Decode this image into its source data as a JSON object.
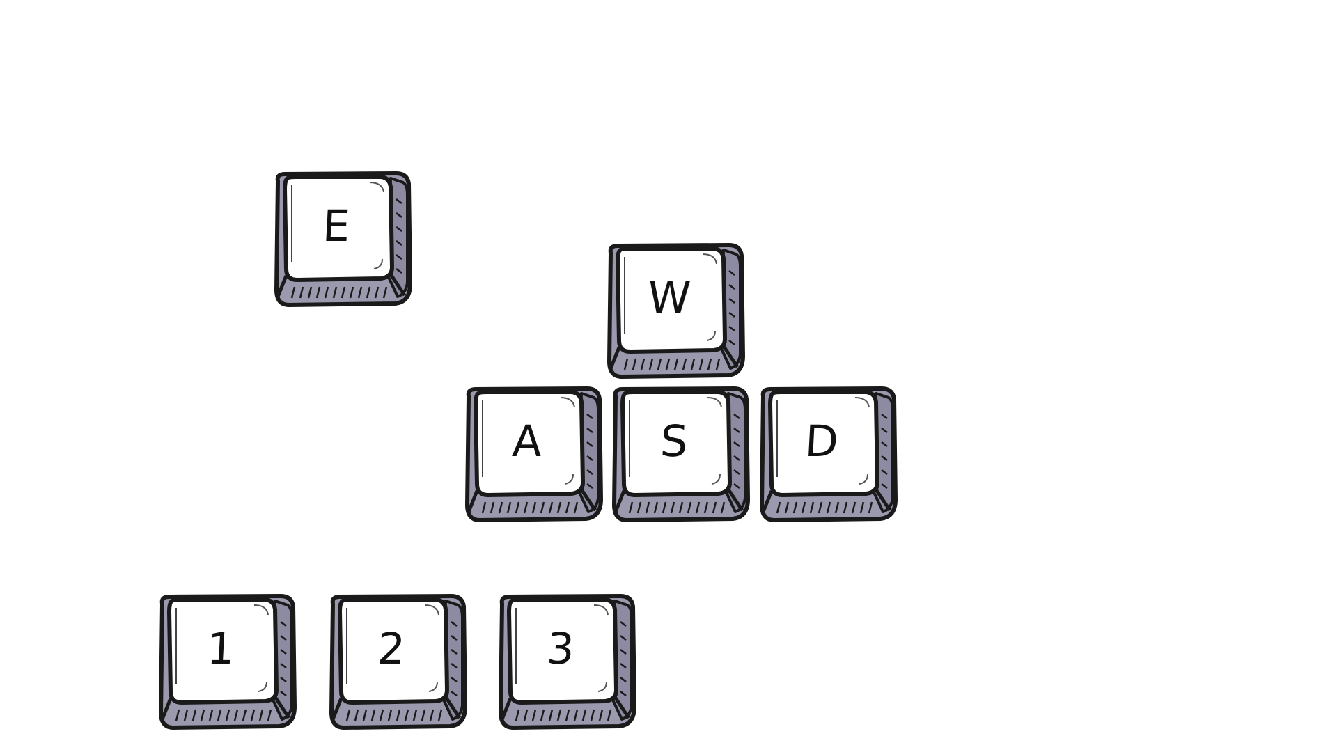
{
  "keys": {
    "e": "E",
    "w": "W",
    "a": "A",
    "s": "S",
    "d": "D",
    "one": "1",
    "two": "2",
    "three": "3"
  },
  "colors": {
    "key_top": "#ffffff",
    "key_side": "#9a99ae",
    "outline": "#1a1a1a",
    "background": "#ffffff"
  }
}
